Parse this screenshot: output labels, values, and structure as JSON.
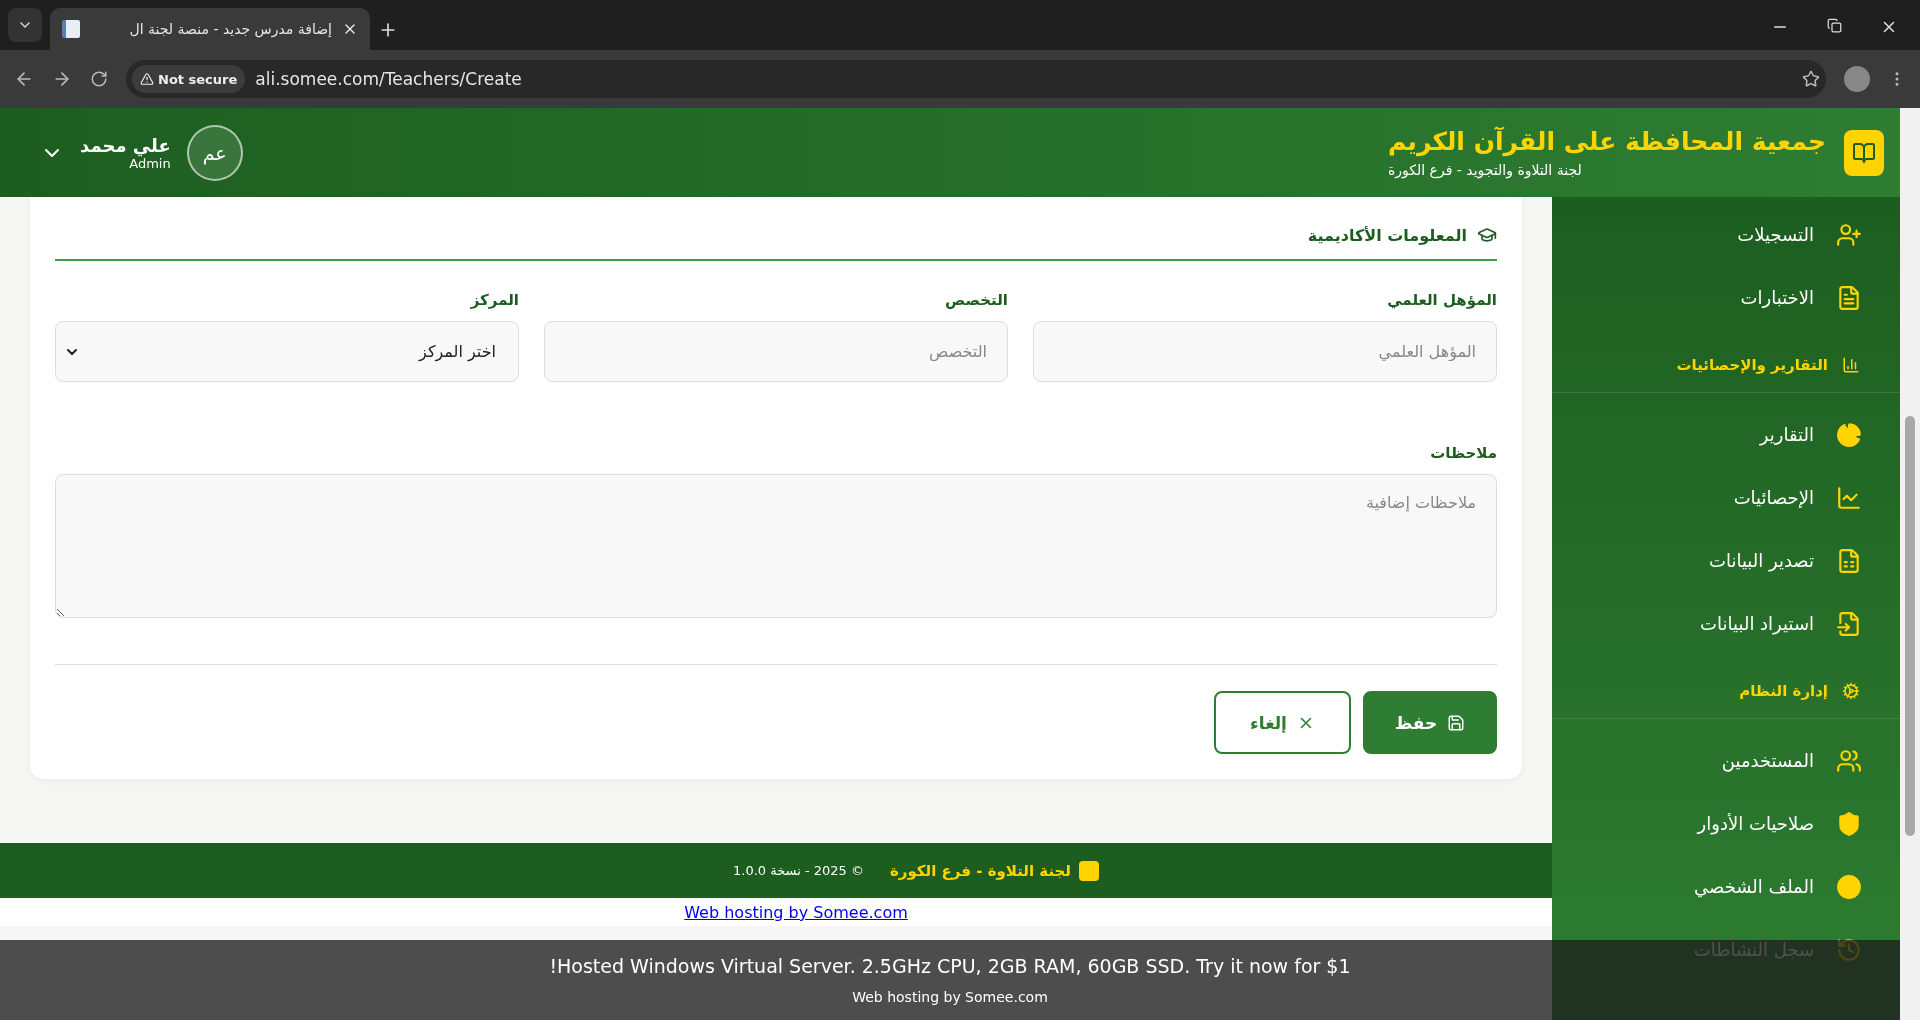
{
  "browser": {
    "tab_title": "إضافة مدرس جديد - منصة لجنة ال",
    "security": "Not secure",
    "url": "ali.somee.com/Teachers/Create"
  },
  "header": {
    "title": "جمعية المحافظة على القرآن الكريم",
    "subtitle": "لجنة التلاوة والتجويد - فرع الكورة",
    "user": {
      "initials": "عم",
      "name": "علي محمد",
      "role": "Admin"
    }
  },
  "sidebar": {
    "items": [
      {
        "kind": "item",
        "label": "التسجيلات"
      },
      {
        "kind": "item",
        "label": "الاختبارات"
      },
      {
        "kind": "section",
        "label": "التقارير والإحصائيات"
      },
      {
        "kind": "item",
        "label": "التقارير"
      },
      {
        "kind": "item",
        "label": "الإحصائيات"
      },
      {
        "kind": "item",
        "label": "تصدير البيانات"
      },
      {
        "kind": "item",
        "label": "استيراد البيانات"
      },
      {
        "kind": "section",
        "label": "إدارة النظام"
      },
      {
        "kind": "item",
        "label": "المستخدمين"
      },
      {
        "kind": "item",
        "label": "صلاحيات الأدوار"
      },
      {
        "kind": "item",
        "label": "الملف الشخصي"
      },
      {
        "kind": "item",
        "label": "سجل النشاطات"
      }
    ]
  },
  "form": {
    "section_title": "المعلومات الأكاديمية",
    "fields": [
      {
        "kind": "input",
        "label": "المؤهل العلمي",
        "placeholder": "المؤهل العلمي"
      },
      {
        "kind": "input",
        "label": "التخصص",
        "placeholder": "التخصص"
      },
      {
        "kind": "select",
        "label": "المركز",
        "value": "اختر المركز"
      }
    ],
    "notes": {
      "label": "ملاحظات",
      "placeholder": "ملاحظات إضافية"
    },
    "buttons": [
      {
        "kind": "primary",
        "label": "حفظ"
      },
      {
        "kind": "outline",
        "label": "إلغاء"
      }
    ]
  },
  "footer": {
    "brand": "لجنة التلاوة - فرع الكورة",
    "copyright": "© 2025 - نسخة 1.0.0"
  },
  "hosting": {
    "link": "Web hosting by Somee.com",
    "ad": "Hosted Windows Virtual Server. 2.5GHz CPU, 2GB RAM, 60GB SSD. Try it now for $1!",
    "credit": "Web hosting by Somee.com"
  }
}
